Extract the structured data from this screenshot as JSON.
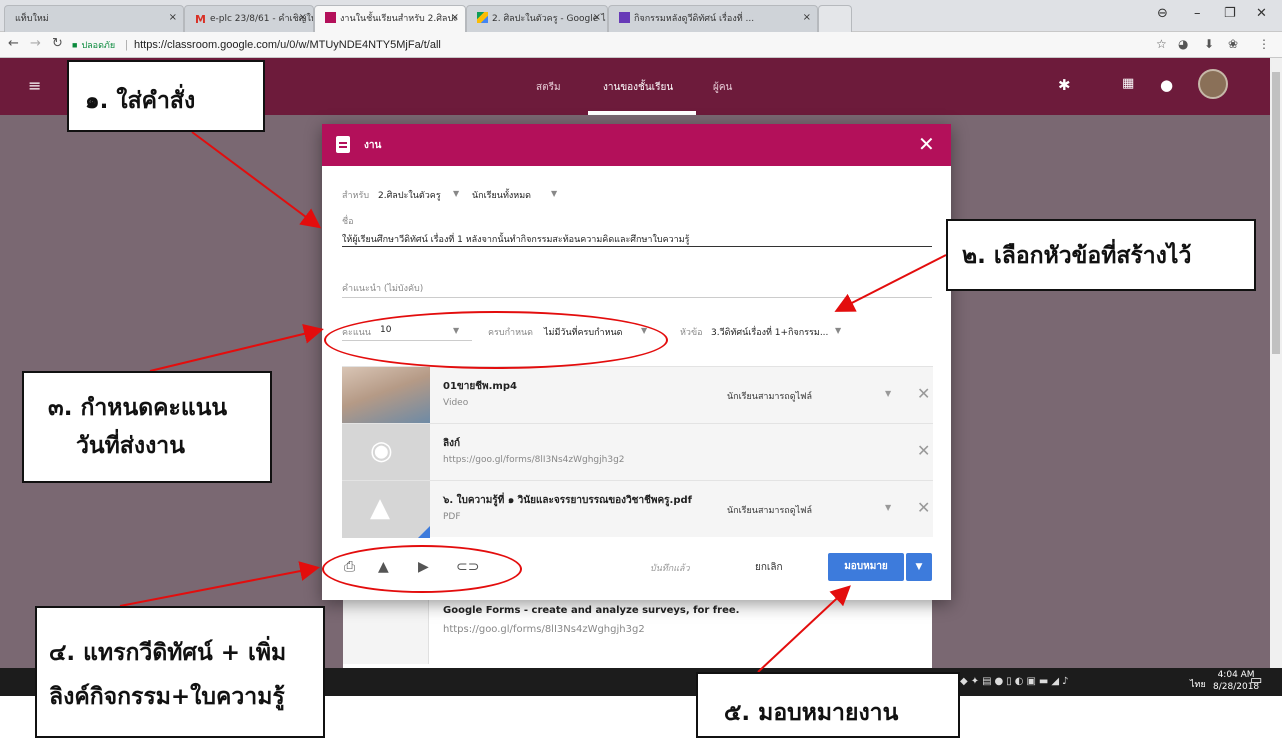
{
  "browser": {
    "tabs": [
      {
        "label": "แท็บใหม่",
        "active": false
      },
      {
        "label": "e-plc 23/8/61 - คำเชิญให้เ",
        "active": false
      },
      {
        "label": "งานในชั้นเรียนสำหรับ 2.ศิลปะ",
        "active": true
      },
      {
        "label": "2. ศิลปะในตัวครู - Google ไ",
        "active": false
      },
      {
        "label": "กิจกรรมหลังดูวีดิทัศน์ เรื่องที่ ...",
        "active": false
      }
    ],
    "tab_close_glyph": "×",
    "security_label": "ปลอดภัย",
    "url": "https://classroom.google.com/u/0/w/MTUyNDE4NTY5MjFa/t/all",
    "accent": "#6d1b3b"
  },
  "classroom": {
    "nav": [
      "สตรีม",
      "งานของชั้นเรียน",
      "ผู้คน"
    ],
    "bg_item": {
      "title": "Google Forms - create and analyze surveys, for free.",
      "url": "https://goo.gl/forms/8lI3Ns4zWghgjh3g2"
    }
  },
  "dialog": {
    "title": "งาน",
    "header_color": "#b3105a",
    "for_label": "สำหรับ",
    "class_name": "2.ศิลปะในตัวครู",
    "students_value": "นักเรียนทั้งหมด",
    "name_label": "ชื่อ",
    "name_value": "ให้ผู้เรียนศึกษาวีดิทัศน์ เรื่องที่ 1 หลังจากนั้นทำกิจกรรมสะท้อนความคิดและศึกษาใบความรู้",
    "instructions_placeholder": "คำแนะนำ (ไม่บังคับ)",
    "points_label": "คะแนน",
    "points_value": "10",
    "due_label": "ครบกำหนด",
    "due_value": "ไม่มีวันที่ครบกำหนด",
    "topic_label": "หัวข้อ",
    "topic_value": "3.วีดิทัศน์เรื่องที่ 1+กิจกรรม...",
    "attachments": [
      {
        "name": "01ขายชีพ.mp4",
        "sub": "Video",
        "permission": "นักเรียนสามารถดูไฟล์"
      },
      {
        "name": "ลิงก์",
        "sub": "https://goo.gl/forms/8lI3Ns4zWghgjh3g2",
        "permission": ""
      },
      {
        "name": "๖. ใบความรู้ที่ ๑ วินัยและจรรยาบรรณของวิชาชีพครู.pdf",
        "sub": "PDF",
        "permission": "นักเรียนสามารถดูไฟล์"
      }
    ],
    "saved_label": "บันทึกแล้ว",
    "cancel_label": "ยกเลิก",
    "assign_label": "มอบหมาย",
    "assign_color": "#3d7bdc"
  },
  "taskbar": {
    "lang": "ไทย",
    "time": "4:04 AM",
    "date": "8/28/2018"
  },
  "callouts": {
    "c1": "๑. ใส่คำสั่ง",
    "c2": "๒. เลือกหัวข้อที่สร้างไว้",
    "c3_line1": "๓. กำหนดคะแนน",
    "c3_line2": "วันที่ส่งงาน",
    "c4_line1": "๔. แทรกวีดิทัศน์ + เพิ่ม",
    "c4_line2": "ลิงค์กิจกรรม+ใบความรู้",
    "c5": "๕. มอบหมายงาน",
    "annotation_color": "#e30d0d"
  }
}
